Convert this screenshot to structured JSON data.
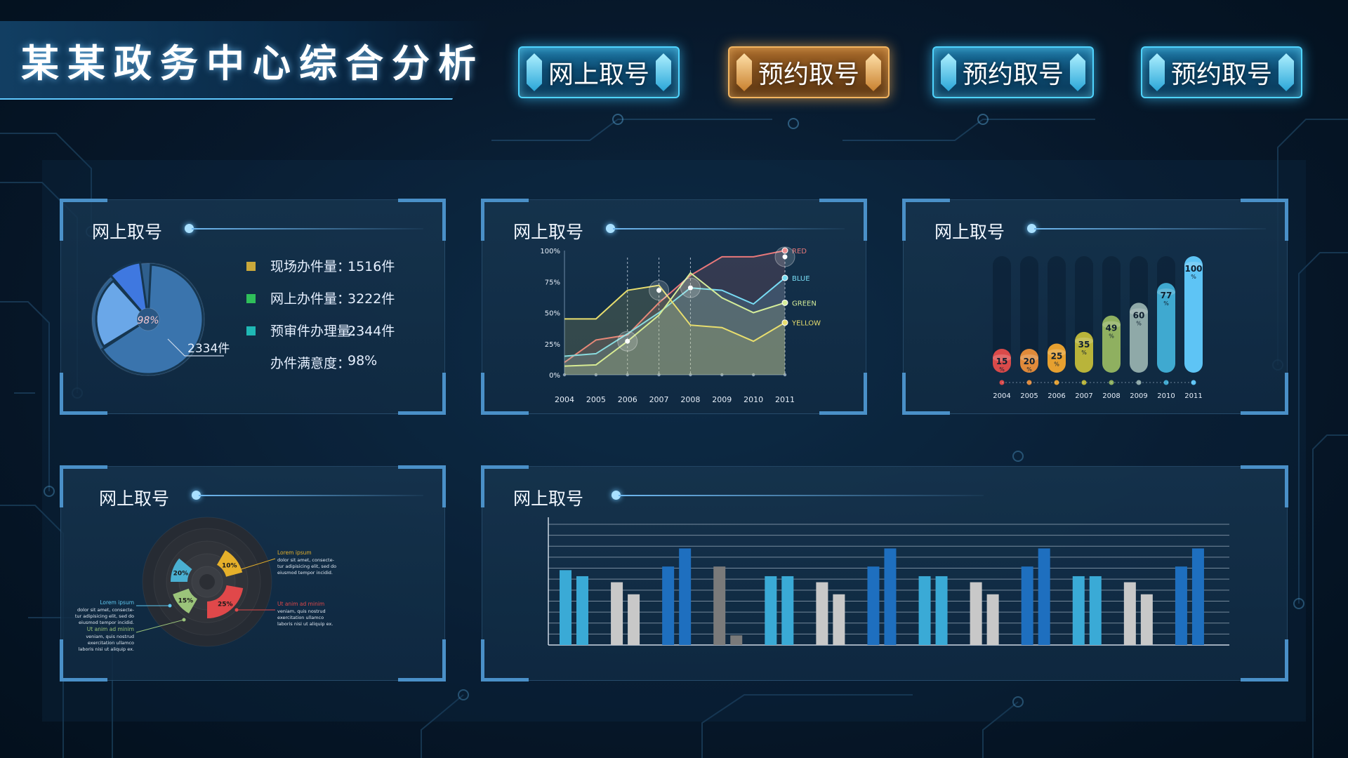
{
  "header": {
    "title": "某某政务中心综合分析",
    "nav": [
      {
        "label": "网上取号",
        "style": "blue"
      },
      {
        "label": "预约取号",
        "style": "gold"
      },
      {
        "label": "预约取号",
        "style": "blue"
      },
      {
        "label": "预约取号",
        "style": "blue"
      }
    ]
  },
  "panels": {
    "p1": {
      "title": "网上取号",
      "stats": [
        {
          "label": "现场办件量：",
          "value": "1516件",
          "color": "#c9a83b"
        },
        {
          "label": "网上办件量：",
          "value": "3222件",
          "color": "#2fbf5a"
        },
        {
          "label": "预审件办理量：",
          "value": "2344件",
          "color": "#1fb8b4"
        },
        {
          "label": "办件满意度：",
          "value": "98%",
          "color": ""
        }
      ],
      "pie_center": "98%",
      "pie_callout": "2334件"
    },
    "p2": {
      "title": "网上取号"
    },
    "p3": {
      "title": "网上取号"
    },
    "p4": {
      "title": "网上取号",
      "annotations": [
        {
          "heading": "Lorem ipsum",
          "body": [
            "dolor sit amet, consecte-",
            "tur adipisicing elit, sed do",
            "eiusmod tempor incidid."
          ]
        },
        {
          "heading": "Ut anim ad minim",
          "body": [
            "veniam, quis nostrud",
            "exercitation ullamco",
            "laboris nisi ut aliquip ex."
          ]
        },
        {
          "heading": "Lorem ipsum",
          "body": [
            "dolor sit amet, consecte-",
            "tur adipisicing elit, sed do",
            "eiusmod tempor incidid."
          ]
        },
        {
          "heading": "Ut anim ad minim",
          "body": [
            "veniam, quis nostrud",
            "exercitation ullamco",
            "laboris nisi ut aliquip ex."
          ]
        }
      ]
    },
    "p5": {
      "title": "网上取号"
    }
  },
  "chart_data": [
    {
      "type": "pie",
      "slices": [
        {
          "value": 65,
          "color": "#3a74ad"
        },
        {
          "value": 22,
          "color": "#6aa7e8"
        },
        {
          "value": 9,
          "color": "#3f78e0"
        }
      ],
      "labels": [
        "98%",
        "2334件"
      ]
    },
    {
      "type": "area",
      "x": [
        "2004",
        "2005",
        "2006",
        "2007",
        "2008",
        "2009",
        "2010",
        "2011"
      ],
      "yticks": [
        "0%",
        "25%",
        "50%",
        "75%",
        "100%"
      ],
      "ylim": [
        0,
        100
      ],
      "series": [
        {
          "name": "RED",
          "color": "#e8787a",
          "values": [
            10,
            28,
            32,
            58,
            80,
            95,
            95,
            100
          ]
        },
        {
          "name": "BLUE",
          "color": "#78dcf4",
          "values": [
            15,
            17,
            33,
            50,
            70,
            68,
            57,
            78
          ]
        },
        {
          "name": "GREEN",
          "color": "#d5ed9a",
          "values": [
            7,
            8,
            27,
            48,
            82,
            62,
            50,
            58
          ]
        },
        {
          "name": "YELLOW",
          "color": "#e8de6e",
          "values": [
            45,
            45,
            68,
            72,
            40,
            38,
            27,
            42
          ]
        }
      ]
    },
    {
      "type": "bar",
      "categories": [
        "2004",
        "2005",
        "2006",
        "2007",
        "2008",
        "2009",
        "2010",
        "2011"
      ],
      "values": [
        15,
        20,
        25,
        35,
        49,
        60,
        77,
        100
      ],
      "value_labels": [
        "15",
        "20",
        "25",
        "35",
        "49",
        "60",
        "77",
        "100"
      ],
      "unit": "%",
      "colors": [
        "#d94a4a",
        "#e08a3a",
        "#e6a030",
        "#b9b43a",
        "#8fb060",
        "#8fa9a8",
        "#3fa9d0",
        "#5ec4f5"
      ]
    },
    {
      "type": "pie",
      "slices": [
        {
          "value": 20,
          "color": "#4ab0d2"
        },
        {
          "value": 15,
          "color": "#9bc47a"
        },
        {
          "value": 25,
          "color": "#e0484a"
        },
        {
          "value": 10,
          "color": "#e6b02a"
        }
      ],
      "labels": [
        "20%",
        "15%",
        "25%",
        "10%"
      ]
    },
    {
      "type": "bar",
      "series": [
        {
          "name": "",
          "values": [
            62,
            57,
            52,
            42,
            65,
            80,
            65,
            8,
            57,
            57,
            52,
            42,
            65,
            80,
            57,
            57,
            52,
            42,
            65,
            80,
            57,
            57,
            52,
            42,
            65,
            80
          ]
        }
      ],
      "colors": [
        "#3aaad6",
        "#3aaad6",
        "#c8c8c8",
        "#c8c8c8",
        "#1e6fbf",
        "#1e6fbf",
        "#7a7a7a",
        "#7a7a7a",
        "#3aaad6",
        "#3aaad6",
        "#c8c8c8",
        "#c8c8c8",
        "#1e6fbf",
        "#1e6fbf",
        "#3aaad6",
        "#3aaad6",
        "#c8c8c8",
        "#c8c8c8",
        "#1e6fbf",
        "#1e6fbf",
        "#3aaad6",
        "#3aaad6",
        "#c8c8c8",
        "#c8c8c8",
        "#1e6fbf",
        "#1e6fbf"
      ],
      "ylim": [
        0,
        100
      ]
    }
  ]
}
